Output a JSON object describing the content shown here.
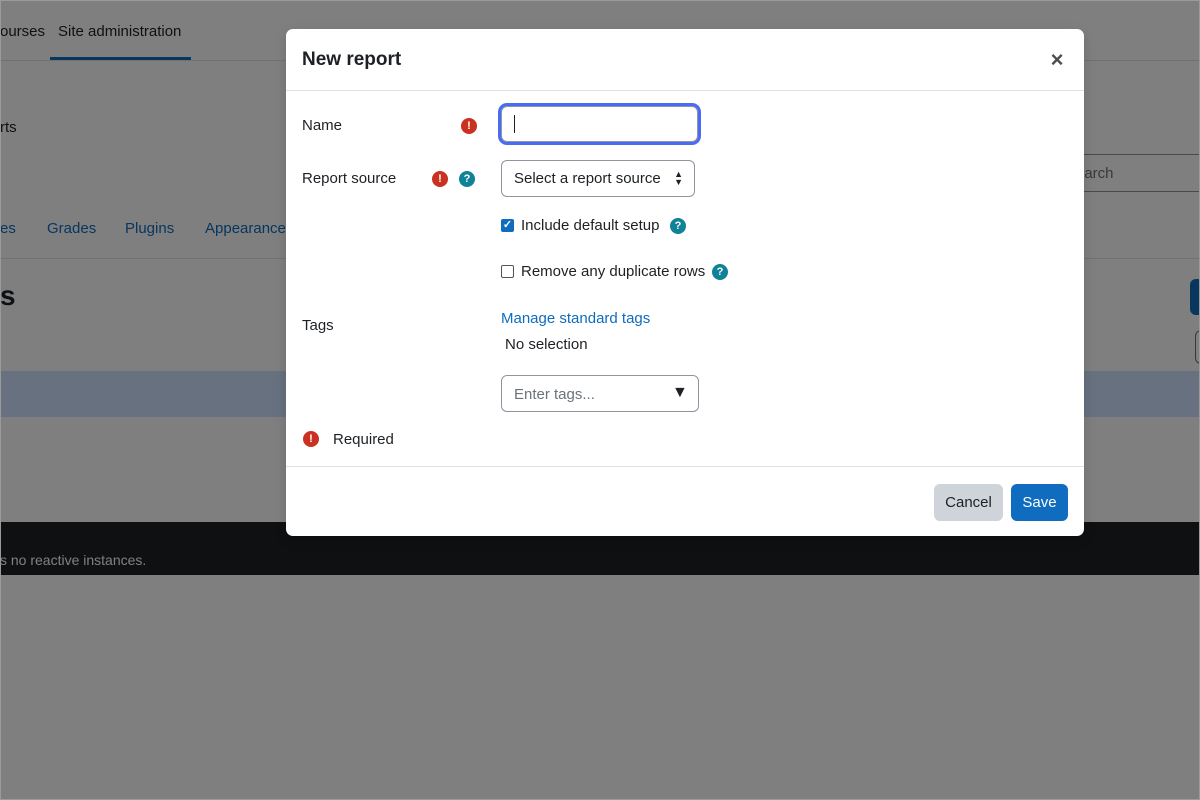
{
  "background": {
    "nav_courses": "ourses",
    "nav_site_admin": "Site administration",
    "reports_link": "rts",
    "tabs": [
      "es",
      "Grades",
      "Plugins",
      "Appearance"
    ],
    "heading": "s",
    "search_placeholder": "earch",
    "footer_text": "s no reactive instances."
  },
  "modal": {
    "title": "New report",
    "close_symbol": "×",
    "name_label": "Name",
    "name_value": "",
    "report_source_label": "Report source",
    "report_source_selected": "Select a report source",
    "include_default_label": "Include default setup",
    "include_default_checked": true,
    "remove_duplicates_label": "Remove any duplicate rows",
    "remove_duplicates_checked": false,
    "tags_label": "Tags",
    "manage_tags_link": "Manage standard tags",
    "no_selection": "No selection",
    "tags_placeholder": "Enter tags...",
    "tags_dropdown_symbol": "▼",
    "required_text": "Required",
    "cancel_label": "Cancel",
    "save_label": "Save"
  },
  "icons": {
    "required": "exclamation-circle-icon",
    "help": "question-circle-icon"
  },
  "colors": {
    "primary": "#0f6cbf",
    "required": "#ca3120",
    "help": "#0f8297"
  }
}
